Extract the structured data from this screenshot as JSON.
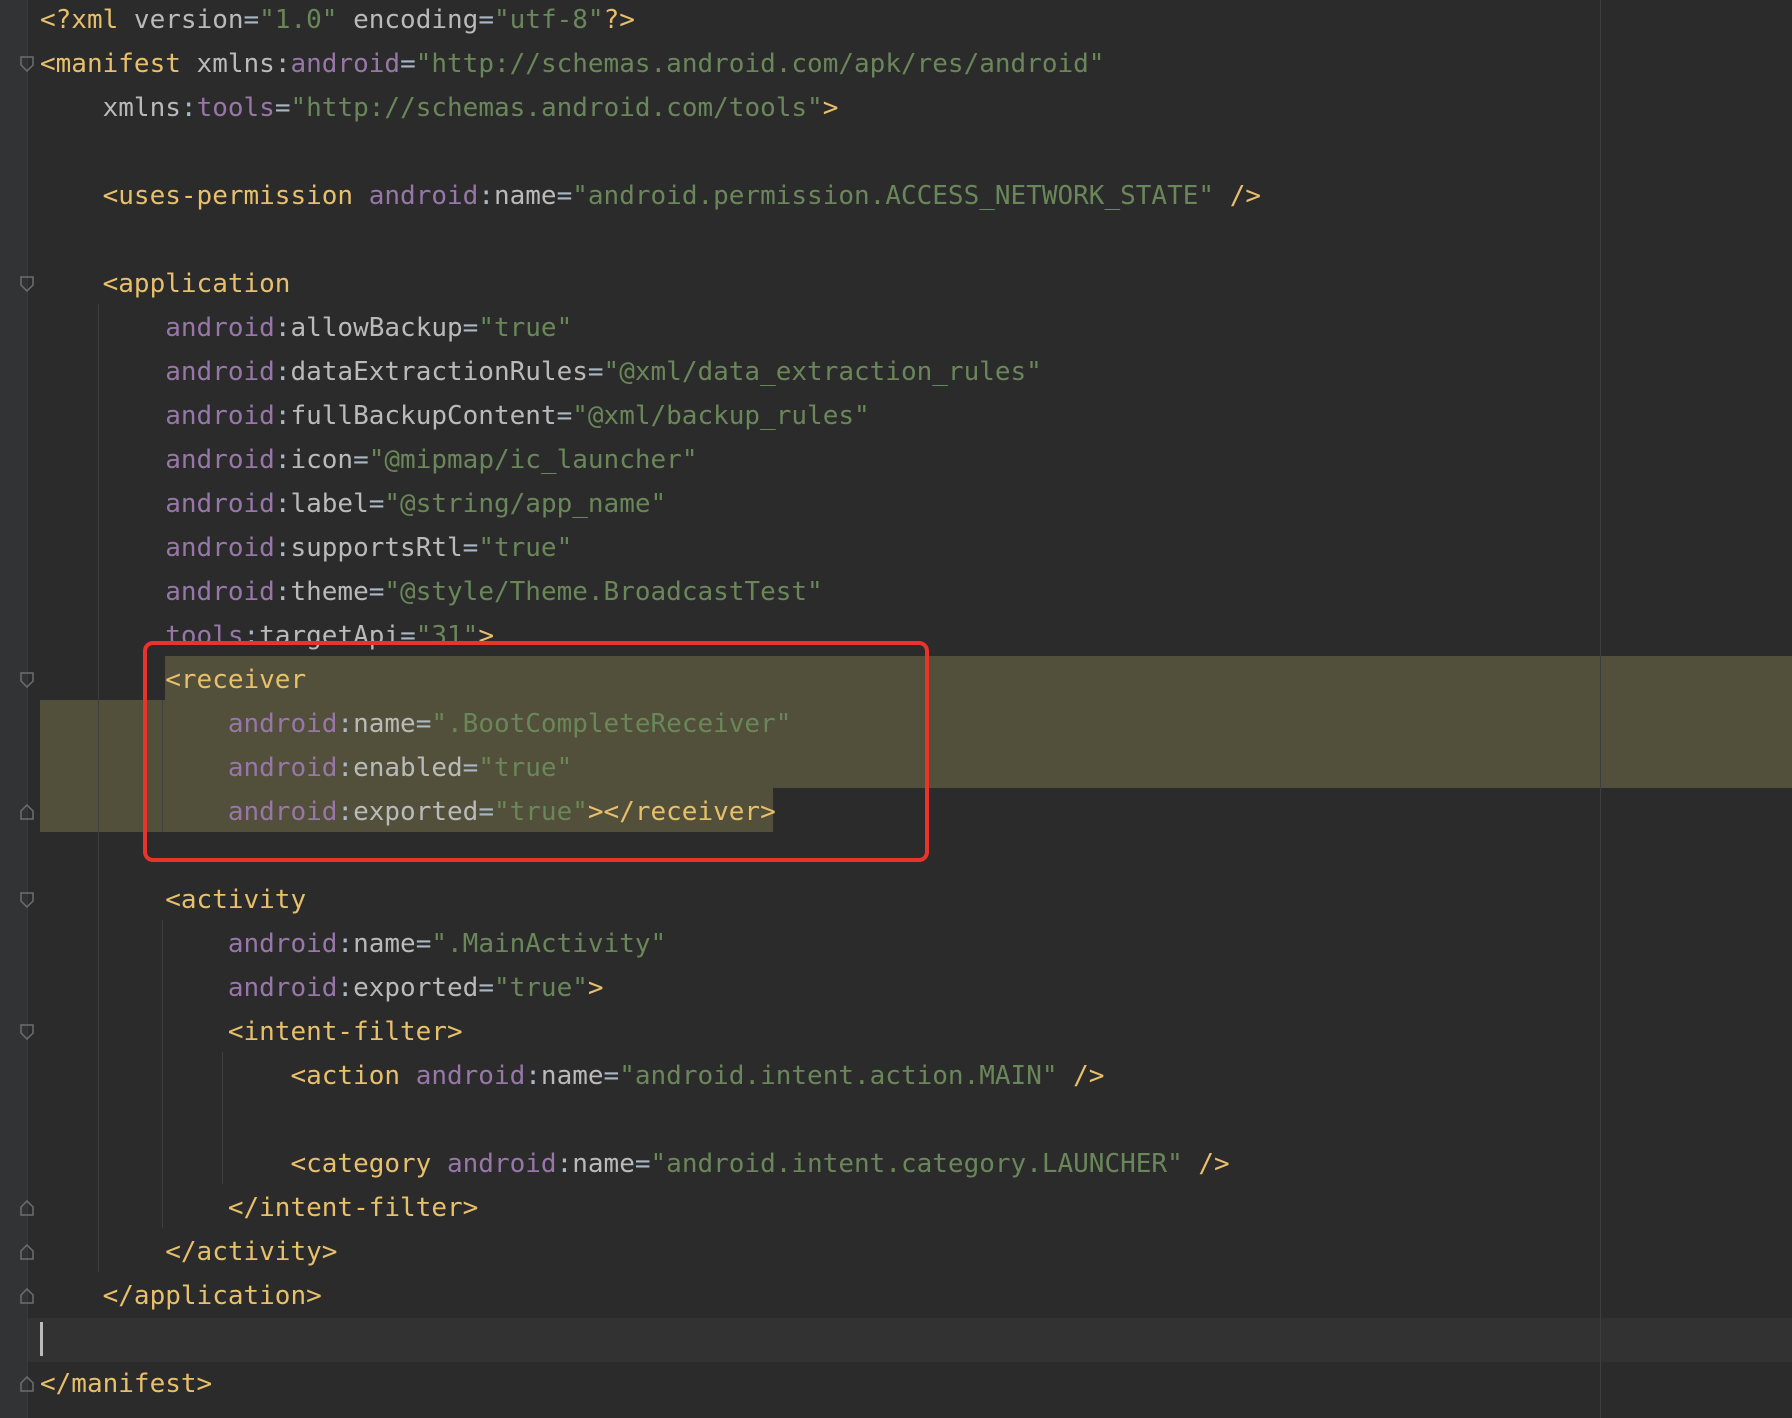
{
  "editor": {
    "file_type": "xml",
    "colors": {
      "background": "#2b2b2b",
      "tag": "#e8bf6a",
      "namespace": "#9876aa",
      "attribute": "#bababa",
      "string": "#6a8759",
      "selection_highlight": "#52503a",
      "annotation_border": "#e8342a"
    },
    "lines": [
      [
        [
          "t-tag",
          "<?xml "
        ],
        [
          "t-attr",
          "version"
        ],
        [
          "t-punct",
          "="
        ],
        [
          "t-str",
          "\"1.0\""
        ],
        [
          "t-punct",
          " "
        ],
        [
          "t-attr",
          "encoding"
        ],
        [
          "t-punct",
          "="
        ],
        [
          "t-str",
          "\"utf-8\""
        ],
        [
          "t-tag",
          "?>"
        ]
      ],
      [
        [
          "t-tag",
          "<manifest "
        ],
        [
          "t-attr",
          "xmlns"
        ],
        [
          "t-punct",
          ":"
        ],
        [
          "t-ns",
          "android"
        ],
        [
          "t-punct",
          "="
        ],
        [
          "t-str",
          "\"http://schemas.android.com/apk/res/android\""
        ]
      ],
      [
        [
          "t-punct",
          "    "
        ],
        [
          "t-attr",
          "xmlns"
        ],
        [
          "t-punct",
          ":"
        ],
        [
          "t-ns",
          "tools"
        ],
        [
          "t-punct",
          "="
        ],
        [
          "t-str",
          "\"http://schemas.android.com/tools\""
        ],
        [
          "t-tag",
          ">"
        ]
      ],
      [],
      [
        [
          "t-punct",
          "    "
        ],
        [
          "t-tag",
          "<uses-permission "
        ],
        [
          "t-ns",
          "android"
        ],
        [
          "t-punct",
          ":"
        ],
        [
          "t-attr",
          "name"
        ],
        [
          "t-punct",
          "="
        ],
        [
          "t-str",
          "\"android.permission.ACCESS_NETWORK_STATE\""
        ],
        [
          "t-punct",
          " "
        ],
        [
          "t-tag",
          "/>"
        ]
      ],
      [],
      [
        [
          "t-punct",
          "    "
        ],
        [
          "t-tag",
          "<application"
        ]
      ],
      [
        [
          "t-punct",
          "        "
        ],
        [
          "t-ns",
          "android"
        ],
        [
          "t-punct",
          ":"
        ],
        [
          "t-attr",
          "allowBackup"
        ],
        [
          "t-punct",
          "="
        ],
        [
          "t-str",
          "\"true\""
        ]
      ],
      [
        [
          "t-punct",
          "        "
        ],
        [
          "t-ns",
          "android"
        ],
        [
          "t-punct",
          ":"
        ],
        [
          "t-attr",
          "dataExtractionRules"
        ],
        [
          "t-punct",
          "="
        ],
        [
          "t-str",
          "\"@xml/data_extraction_rules\""
        ]
      ],
      [
        [
          "t-punct",
          "        "
        ],
        [
          "t-ns",
          "android"
        ],
        [
          "t-punct",
          ":"
        ],
        [
          "t-attr",
          "fullBackupContent"
        ],
        [
          "t-punct",
          "="
        ],
        [
          "t-str",
          "\"@xml/backup_rules\""
        ]
      ],
      [
        [
          "t-punct",
          "        "
        ],
        [
          "t-ns",
          "android"
        ],
        [
          "t-punct",
          ":"
        ],
        [
          "t-attr",
          "icon"
        ],
        [
          "t-punct",
          "="
        ],
        [
          "t-str",
          "\"@mipmap/ic_launcher\""
        ]
      ],
      [
        [
          "t-punct",
          "        "
        ],
        [
          "t-ns",
          "android"
        ],
        [
          "t-punct",
          ":"
        ],
        [
          "t-attr",
          "label"
        ],
        [
          "t-punct",
          "="
        ],
        [
          "t-str",
          "\"@string/app_name\""
        ]
      ],
      [
        [
          "t-punct",
          "        "
        ],
        [
          "t-ns",
          "android"
        ],
        [
          "t-punct",
          ":"
        ],
        [
          "t-attr",
          "supportsRtl"
        ],
        [
          "t-punct",
          "="
        ],
        [
          "t-str",
          "\"true\""
        ]
      ],
      [
        [
          "t-punct",
          "        "
        ],
        [
          "t-ns",
          "android"
        ],
        [
          "t-punct",
          ":"
        ],
        [
          "t-attr",
          "theme"
        ],
        [
          "t-punct",
          "="
        ],
        [
          "t-str",
          "\"@style/Theme.BroadcastTest\""
        ]
      ],
      [
        [
          "t-punct",
          "        "
        ],
        [
          "t-ns",
          "tools"
        ],
        [
          "t-punct",
          ":"
        ],
        [
          "t-attr",
          "targetApi"
        ],
        [
          "t-punct",
          "="
        ],
        [
          "t-str",
          "\"31\""
        ],
        [
          "t-tag",
          ">"
        ]
      ],
      [
        [
          "t-punct",
          "        "
        ],
        [
          "t-tag",
          "<receiver"
        ]
      ],
      [
        [
          "t-punct",
          "            "
        ],
        [
          "t-ns",
          "android"
        ],
        [
          "t-punct",
          ":"
        ],
        [
          "t-attr",
          "name"
        ],
        [
          "t-punct",
          "="
        ],
        [
          "t-str",
          "\".BootCompleteReceiver\""
        ]
      ],
      [
        [
          "t-punct",
          "            "
        ],
        [
          "t-ns",
          "android"
        ],
        [
          "t-punct",
          ":"
        ],
        [
          "t-attr",
          "enabled"
        ],
        [
          "t-punct",
          "="
        ],
        [
          "t-str",
          "\"true\""
        ]
      ],
      [
        [
          "t-punct",
          "            "
        ],
        [
          "t-ns",
          "android"
        ],
        [
          "t-punct",
          ":"
        ],
        [
          "t-attr",
          "exported"
        ],
        [
          "t-punct",
          "="
        ],
        [
          "t-str",
          "\"true\""
        ],
        [
          "t-tag",
          "></receiver>"
        ]
      ],
      [],
      [
        [
          "t-punct",
          "        "
        ],
        [
          "t-tag",
          "<activity"
        ]
      ],
      [
        [
          "t-punct",
          "            "
        ],
        [
          "t-ns",
          "android"
        ],
        [
          "t-punct",
          ":"
        ],
        [
          "t-attr",
          "name"
        ],
        [
          "t-punct",
          "="
        ],
        [
          "t-str",
          "\".MainActivity\""
        ]
      ],
      [
        [
          "t-punct",
          "            "
        ],
        [
          "t-ns",
          "android"
        ],
        [
          "t-punct",
          ":"
        ],
        [
          "t-attr",
          "exported"
        ],
        [
          "t-punct",
          "="
        ],
        [
          "t-str",
          "\"true\""
        ],
        [
          "t-tag",
          ">"
        ]
      ],
      [
        [
          "t-punct",
          "            "
        ],
        [
          "t-tag",
          "<intent-filter>"
        ]
      ],
      [
        [
          "t-punct",
          "                "
        ],
        [
          "t-tag",
          "<action "
        ],
        [
          "t-ns",
          "android"
        ],
        [
          "t-punct",
          ":"
        ],
        [
          "t-attr",
          "name"
        ],
        [
          "t-punct",
          "="
        ],
        [
          "t-str",
          "\"android.intent.action.MAIN\""
        ],
        [
          "t-punct",
          " "
        ],
        [
          "t-tag",
          "/>"
        ]
      ],
      [],
      [
        [
          "t-punct",
          "                "
        ],
        [
          "t-tag",
          "<category "
        ],
        [
          "t-ns",
          "android"
        ],
        [
          "t-punct",
          ":"
        ],
        [
          "t-attr",
          "name"
        ],
        [
          "t-punct",
          "="
        ],
        [
          "t-str",
          "\"android.intent.category.LAUNCHER\""
        ],
        [
          "t-punct",
          " "
        ],
        [
          "t-tag",
          "/>"
        ]
      ],
      [
        [
          "t-punct",
          "            "
        ],
        [
          "t-tag",
          "</intent-filter>"
        ]
      ],
      [
        [
          "t-punct",
          "        "
        ],
        [
          "t-tag",
          "</activity>"
        ]
      ],
      [
        [
          "t-punct",
          "    "
        ],
        [
          "t-tag",
          "</application>"
        ]
      ],
      [],
      [
        [
          "t-tag",
          "</manifest>"
        ]
      ]
    ]
  }
}
